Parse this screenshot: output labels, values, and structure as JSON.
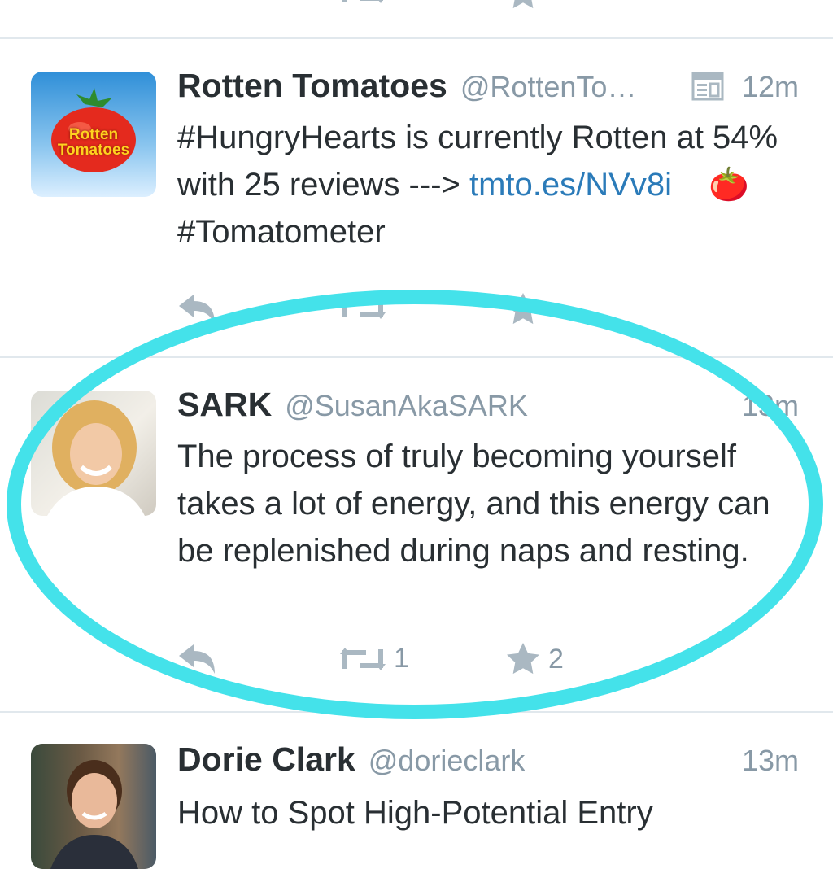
{
  "timeline": {
    "tweets": [
      {
        "name": "Rotten Tomatoes",
        "handle": "@RottenTo…",
        "time": "12m",
        "text_part1": "#HungryHearts is currently Rotten at 54% with 25 reviews ---> ",
        "link": "tmto.es/NVv8i",
        "text_part2": " #Tomatometer",
        "emoji": "🍅",
        "avatar_logo_text": "Rotten Tomatoes",
        "has_summary_card": true
      },
      {
        "name": "SARK",
        "handle": "@SusanAkaSARK",
        "time": "13m",
        "text": "The process of truly becoming yourself takes a lot of energy, and this energy can be replenished during naps and resting.",
        "retweets": "1",
        "favorites": "2"
      },
      {
        "name": "Dorie Clark",
        "handle": "@dorieclark",
        "time": "13m",
        "text": "How to Spot High-Potential Entry"
      }
    ]
  },
  "colors": {
    "link": "#2b7bb9",
    "highlight_ring": "#44e2ea",
    "action_icon": "#aab8c2",
    "separator": "#e1e8ed"
  },
  "icons": [
    "reply-icon",
    "retweet-icon",
    "favorite-icon",
    "summary-card-icon"
  ]
}
